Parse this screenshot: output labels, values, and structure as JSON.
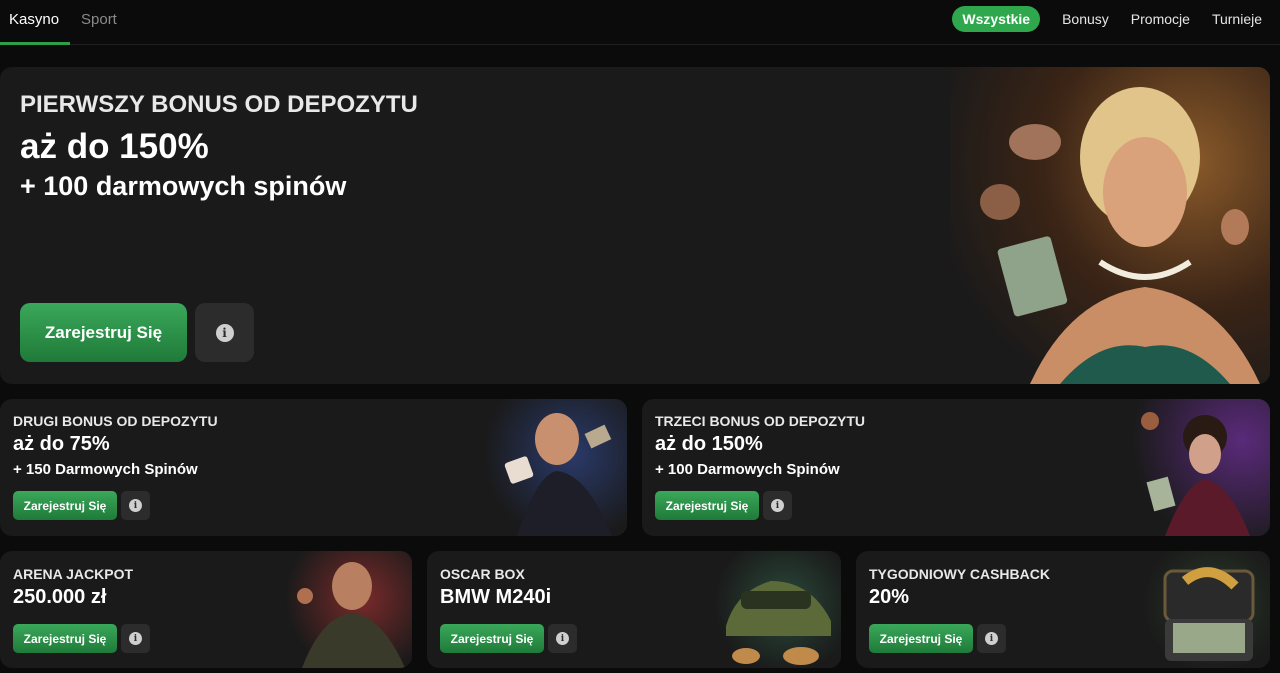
{
  "nav": {
    "tabs": [
      {
        "label": "Kasyno"
      },
      {
        "label": "Sport"
      }
    ],
    "filters": [
      {
        "label": "Wszystkie"
      },
      {
        "label": "Bonusy"
      },
      {
        "label": "Promocje"
      },
      {
        "label": "Turnieje"
      }
    ]
  },
  "hero": {
    "kicker": "PIERWSZY BONUS OD DEPOZYTU",
    "amount": "aż do 150%",
    "extra": "+ 100 darmowych spinów",
    "cta": "Zarejestruj Się",
    "info": "i"
  },
  "cards": [
    {
      "title": "DRUGI BONUS OD DEPOZYTU",
      "amount": "aż do 75%",
      "extra": "+ 150 Darmowych Spinów",
      "cta": "Zarejestruj Się",
      "info": "i"
    },
    {
      "title": "TRZECI BONUS OD DEPOZYTU",
      "amount": "aż do 150%",
      "extra": "+ 100 Darmowych Spinów",
      "cta": "Zarejestruj Się",
      "info": "i"
    },
    {
      "title": "ARENA JACKPOT",
      "amount": "250.000 zł",
      "cta": "Zarejestruj Się",
      "info": "i"
    },
    {
      "title": "OSCAR BOX",
      "amount": "BMW M240i",
      "cta": "Zarejestruj Się",
      "info": "i"
    },
    {
      "title": "TYGODNIOWY CASHBACK",
      "amount": "20%",
      "cta": "Zarejestruj Się",
      "info": "i"
    }
  ],
  "colors": {
    "accent": "#2fa84d",
    "card_bg": "#1a1a1a",
    "page_bg": "#0b0b0b"
  }
}
